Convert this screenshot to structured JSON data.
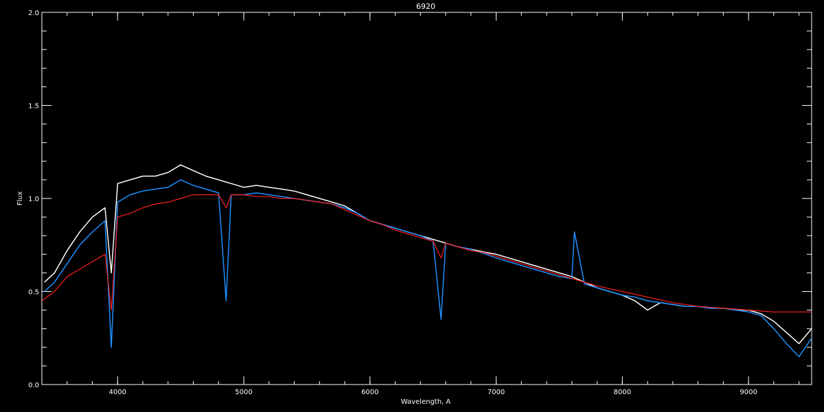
{
  "chart_data": {
    "type": "line",
    "title": "6920",
    "xlabel": "Wavelength, A",
    "ylabel": "Flux",
    "xlim": [
      3400,
      9500
    ],
    "ylim": [
      0.0,
      2.0
    ],
    "x_ticks": [
      {
        "value": 4000,
        "label": "4000"
      },
      {
        "value": 5000,
        "label": "5000"
      },
      {
        "value": 6000,
        "label": "6000"
      },
      {
        "value": 7000,
        "label": "7000"
      },
      {
        "value": 8000,
        "label": "8000"
      },
      {
        "value": 9000,
        "label": "9000"
      }
    ],
    "y_ticks": [
      {
        "value": 0.0,
        "label": "0.0"
      },
      {
        "value": 0.5,
        "label": "0.5"
      },
      {
        "value": 1.0,
        "label": "1.0"
      },
      {
        "value": 1.5,
        "label": "1.5"
      },
      {
        "value": 2.0,
        "label": "2.0"
      }
    ],
    "x_minor_step": 200,
    "y_minor_step": 0.1,
    "background": "#000000",
    "axis_color": "#ffffff",
    "grid": false,
    "legend": "none",
    "series": [
      {
        "color": "#ffffff",
        "x": [
          3420,
          3500,
          3600,
          3700,
          3800,
          3900,
          3950,
          4000,
          4100,
          4200,
          4300,
          4400,
          4500,
          4600,
          4700,
          4800,
          4900,
          5000,
          5100,
          5200,
          5300,
          5400,
          5500,
          5600,
          5700,
          5800,
          5900,
          6000,
          6100,
          6200,
          6300,
          6400,
          6500,
          6600,
          6700,
          6780,
          6920,
          7000,
          7100,
          7200,
          7300,
          7400,
          7500,
          7600,
          7700,
          7800,
          7900,
          8000,
          8100,
          8200,
          8300,
          8400,
          8500,
          8600,
          8700,
          8800,
          8900,
          9000,
          9100,
          9200,
          9300,
          9400,
          9500
        ],
        "y": [
          0.55,
          0.6,
          0.72,
          0.82,
          0.9,
          0.95,
          0.6,
          1.08,
          1.1,
          1.12,
          1.12,
          1.14,
          1.18,
          1.15,
          1.12,
          1.1,
          1.08,
          1.06,
          1.07,
          1.06,
          1.05,
          1.04,
          1.02,
          1.0,
          0.98,
          0.96,
          0.92,
          0.88,
          0.86,
          0.84,
          0.82,
          0.8,
          0.78,
          0.76,
          0.74,
          0.73,
          0.71,
          0.7,
          0.68,
          0.66,
          0.64,
          0.62,
          0.6,
          0.58,
          0.55,
          0.52,
          0.5,
          0.48,
          0.45,
          0.4,
          0.44,
          0.43,
          0.42,
          0.42,
          0.41,
          0.41,
          0.4,
          0.4,
          0.38,
          0.34,
          0.28,
          0.22,
          0.3
        ]
      },
      {
        "color": "#1e90ff",
        "x": [
          3420,
          3500,
          3600,
          3700,
          3800,
          3900,
          3950,
          4000,
          4100,
          4200,
          4300,
          4400,
          4500,
          4600,
          4700,
          4800,
          4860,
          4900,
          5000,
          5100,
          5200,
          5300,
          5400,
          5500,
          5600,
          5700,
          5800,
          5900,
          6000,
          6100,
          6200,
          6300,
          6400,
          6500,
          6563,
          6600,
          6700,
          6780,
          6920,
          7000,
          7100,
          7200,
          7300,
          7400,
          7500,
          7600,
          7620,
          7700,
          7800,
          7900,
          8000,
          8100,
          8200,
          8300,
          8400,
          8500,
          8600,
          8700,
          8800,
          8900,
          9000,
          9100,
          9200,
          9300,
          9400,
          9500
        ],
        "y": [
          0.5,
          0.55,
          0.65,
          0.75,
          0.82,
          0.88,
          0.2,
          0.98,
          1.02,
          1.04,
          1.05,
          1.06,
          1.1,
          1.07,
          1.05,
          1.03,
          0.45,
          1.02,
          1.02,
          1.03,
          1.02,
          1.01,
          1.0,
          0.99,
          0.98,
          0.97,
          0.95,
          0.92,
          0.88,
          0.86,
          0.84,
          0.82,
          0.8,
          0.77,
          0.35,
          0.76,
          0.74,
          0.73,
          0.7,
          0.68,
          0.66,
          0.64,
          0.62,
          0.6,
          0.58,
          0.57,
          0.82,
          0.54,
          0.52,
          0.5,
          0.48,
          0.47,
          0.45,
          0.44,
          0.43,
          0.42,
          0.42,
          0.41,
          0.41,
          0.4,
          0.39,
          0.37,
          0.3,
          0.22,
          0.15,
          0.25
        ]
      },
      {
        "color": "#ff2020",
        "x": [
          3400,
          3500,
          3600,
          3700,
          3800,
          3900,
          3950,
          4000,
          4100,
          4200,
          4300,
          4400,
          4500,
          4600,
          4700,
          4800,
          4860,
          4900,
          5000,
          5100,
          5200,
          5300,
          5400,
          5500,
          5600,
          5700,
          5800,
          5900,
          6000,
          6100,
          6200,
          6300,
          6400,
          6500,
          6563,
          6600,
          6700,
          6800,
          6900,
          7000,
          7200,
          7400,
          7600,
          7800,
          8000,
          8200,
          8400,
          8600,
          8800,
          9000,
          9200,
          9400,
          9500
        ],
        "y": [
          0.45,
          0.5,
          0.58,
          0.62,
          0.66,
          0.7,
          0.4,
          0.9,
          0.92,
          0.95,
          0.97,
          0.98,
          1.0,
          1.02,
          1.02,
          1.02,
          0.95,
          1.02,
          1.02,
          1.01,
          1.01,
          1.0,
          1.0,
          0.99,
          0.98,
          0.97,
          0.94,
          0.91,
          0.88,
          0.86,
          0.83,
          0.81,
          0.79,
          0.77,
          0.68,
          0.76,
          0.74,
          0.72,
          0.71,
          0.69,
          0.65,
          0.61,
          0.57,
          0.53,
          0.5,
          0.47,
          0.44,
          0.42,
          0.41,
          0.4,
          0.39,
          0.39,
          0.39
        ]
      }
    ]
  }
}
